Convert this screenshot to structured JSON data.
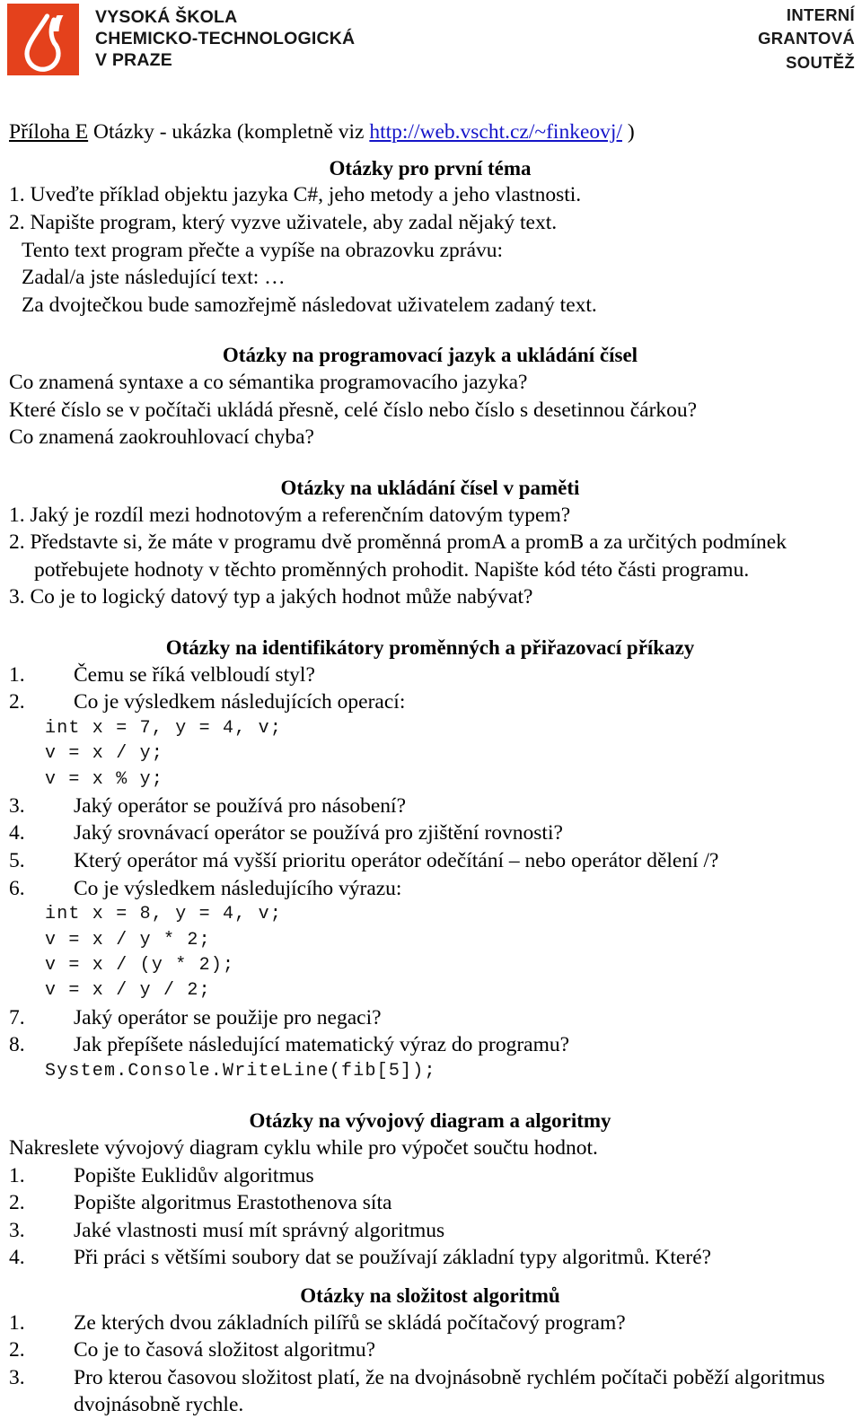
{
  "header": {
    "logo": {
      "icon_name": "vscht-flask-logo",
      "color": "#E4411C",
      "wordmark_lines": [
        "VYSOKÁ ŠKOLA",
        "CHEMICKO-TECHNOLOGICKÁ",
        "V PRAZE"
      ]
    },
    "right_lines": [
      "INTERNÍ",
      "GRANTOVÁ",
      "SOUTĚŽ"
    ]
  },
  "doc_title": {
    "underlined_prefix": "Příloha E",
    "rest_before_link": " Otázky - ukázka (kompletně viz ",
    "link_text": "http://web.vscht.cz/~finkeovj/",
    "rest_after_link": " )"
  },
  "sections": [
    {
      "heading": "Otázky pro první téma",
      "items": [
        {
          "num": "1.",
          "text": "Uveďte příklad objektu jazyka C#, jeho metody a jeho vlastnosti."
        },
        {
          "num": "2.",
          "text": "Napište program, který vyzve uživatele, aby zadal nějaký text."
        }
      ],
      "after_lines": [
        "Tento text program přečte a vypíše na obrazovku zprávu:",
        "Zadal/a jste následující text: …",
        "Za dvojtečkou bude samozřejmě následovat uživatelem zadaný text."
      ]
    },
    {
      "heading": "Otázky na programovací jazyk a ukládání čísel",
      "lines": [
        "Co znamená syntaxe a co sémantika programovacího jazyka?",
        "Které číslo se v počítači ukládá přesně, celé číslo nebo číslo s desetinnou čárkou?",
        "Co znamená zaokrouhlovací chyba?"
      ]
    },
    {
      "heading": "Otázky na ukládání čísel v paměti",
      "items": [
        {
          "num": "1.",
          "text": "Jaký je rozdíl mezi hodnotovým a referenčním datovým typem?"
        },
        {
          "num": "2.",
          "text": "Představte si, že máte v programu dvě proměnná promA a promB a za určitých podmínek potřebujete hodnoty v těchto proměnných prohodit. Napište kód této části programu."
        },
        {
          "num": "3.",
          "text": "Co je to logický datový typ a jakých hodnot může nabývat?"
        }
      ]
    },
    {
      "heading": "Otázky na identifikátory proměnných a přiřazovací příkazy",
      "items": [
        {
          "num": "1.",
          "text": "Čemu se říká velbloudí styl?"
        },
        {
          "num": "2.",
          "text": "Co je výsledkem následujících operací:",
          "code": "int x = 7, y = 4, v;\nv = x / y;\nv = x % y;"
        },
        {
          "num": "3.",
          "text": "Jaký operátor se používá pro násobení?"
        },
        {
          "num": "4.",
          "text": "Jaký srovnávací operátor se používá pro zjištění rovnosti?"
        },
        {
          "num": "5.",
          "text": "Který operátor má vyšší prioritu operátor odečítání – nebo operátor dělení /?"
        },
        {
          "num": "6.",
          "text": "Co je výsledkem následujícího výrazu:",
          "code": "int x = 8, y = 4, v;\nv = x / y * 2;\nv = x / (y * 2);\nv = x / y / 2;"
        },
        {
          "num": "7.",
          "text": "Jaký operátor se použije pro negaci?"
        },
        {
          "num": "8.",
          "text": "Jak přepíšete následující matematický výraz do programu?",
          "code": "System.Console.WriteLine(fib[5]);"
        }
      ]
    },
    {
      "heading": "Otázky na vývojový diagram a algoritmy",
      "intro": "Nakreslete vývojový diagram cyklu while pro výpočet součtu hodnot.",
      "items": [
        {
          "num": "1.",
          "text": "Popište Euklidův algoritmus"
        },
        {
          "num": "2.",
          "text": "Popište algoritmus Erastothenova síta"
        },
        {
          "num": "3.",
          "text": "Jaké vlastnosti musí mít správný algoritmus"
        },
        {
          "num": "4.",
          "text": "Při práci s většími soubory dat se používají základní typy algoritmů. Které?"
        }
      ]
    },
    {
      "heading": "Otázky na složitost algoritmů",
      "items": [
        {
          "num": "1.",
          "text": "Ze kterých dvou základních pilířů se skládá počítačový program?"
        },
        {
          "num": "2.",
          "text": "Co je to časová složitost algoritmu?"
        },
        {
          "num": "3.",
          "text": "Pro kterou časovou složitost platí, že na dvojnásobně rychlém počítači poběží algoritmus dvojnásobně rychle."
        }
      ]
    }
  ]
}
